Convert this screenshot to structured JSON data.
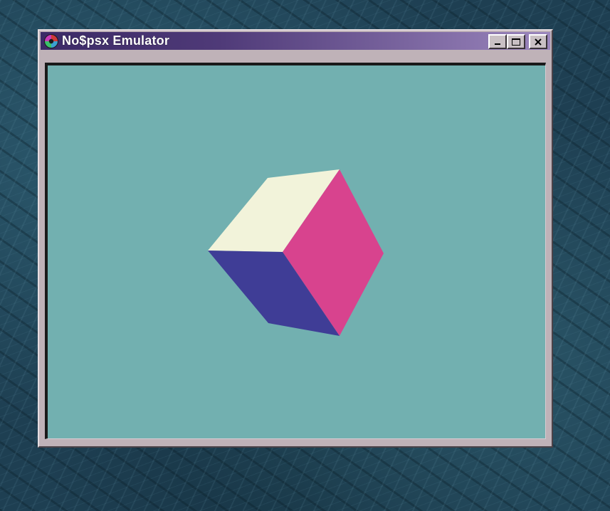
{
  "window": {
    "title": "No$psx Emulator",
    "buttons": {
      "minimize_icon": "minimize-icon",
      "maximize_icon": "maximize-icon",
      "close_icon": "close-icon"
    }
  },
  "display": {
    "background_color": "#72b0b0",
    "cube_faces": {
      "top": "#f2f3da",
      "right": "#d8438e",
      "left": "#3f3d96"
    }
  }
}
